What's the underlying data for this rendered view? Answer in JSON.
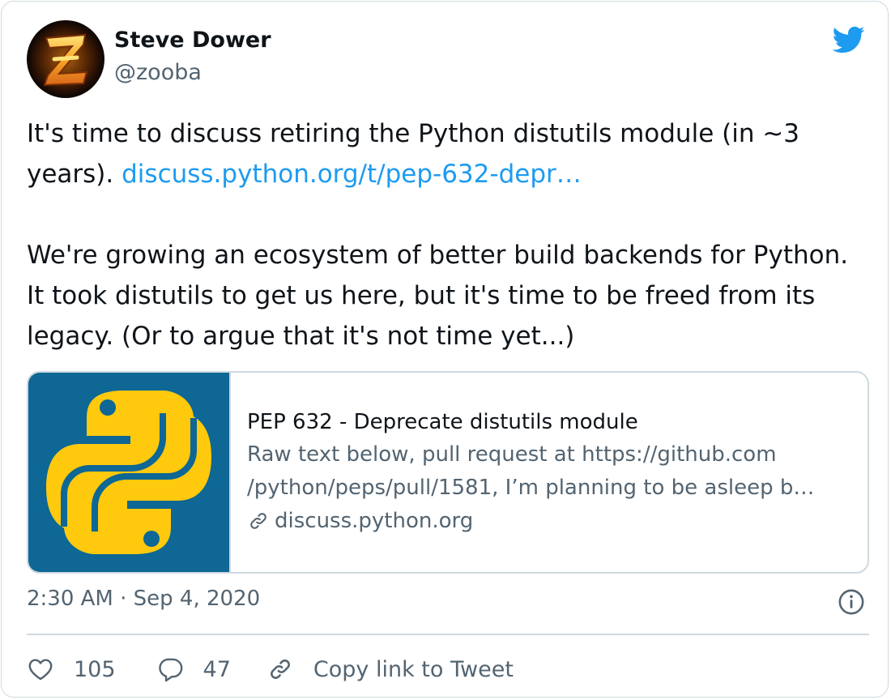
{
  "author": {
    "name": "Steve Dower",
    "handle": "@zooba",
    "avatar_icon": "z-logo-avatar"
  },
  "tweet": {
    "line1_text": "It's time to discuss retiring the Python distutils module (in ~3 years).",
    "line1_link": "discuss.python.org/t/pep-632-depr…",
    "paragraph2": "We're growing an ecosystem of better build backends for Python. It took distutils to get us here, but it's time to be freed from its legacy. (Or to argue that it's not time yet...)"
  },
  "link_preview": {
    "image_icon": "python-logo",
    "title": "PEP 632 - Deprecate distutils module",
    "description_line1": "Raw text below, pull request at https://github.com",
    "description_line2": "/python/peps/pull/1581, I’m planning to be asleep b…",
    "domain": "discuss.python.org",
    "domain_icon": "link-icon"
  },
  "timestamp": "2:30 AM · Sep 4, 2020",
  "actions": {
    "likes": "105",
    "replies": "47",
    "copy_link_label": "Copy link to Tweet"
  },
  "colors": {
    "link": "#1d9bf0",
    "twitter_blue": "#1d9bf0",
    "secondary_text": "#536471",
    "border": "#cfd9de",
    "python_bg": "#0e6794",
    "python_yellow": "#ffc90e"
  }
}
